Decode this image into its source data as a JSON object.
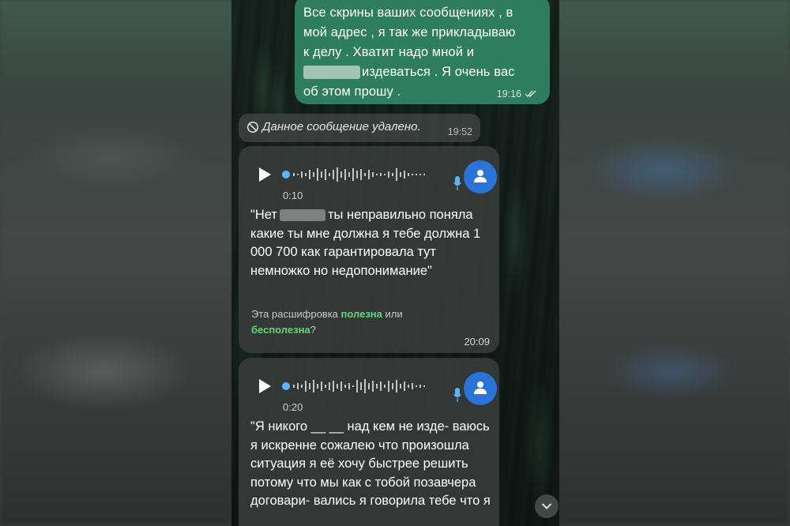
{
  "outgoing": {
    "text_line1": "Все скрины ваших сообщениях , в",
    "text_line2": "мой адрес , я так же прикладываю",
    "text_line3": "к делу . Хватит надо мной и",
    "text_line4": "издеваться . Я очень вас",
    "text_line5": "об этом прошу .",
    "time": "19:16",
    "status_icon": "double-check-icon"
  },
  "deleted": {
    "icon": "block-icon",
    "label": "Данное сообщение удалено.",
    "time": "19:52"
  },
  "voice_messages": [
    {
      "duration": "0:10",
      "transcript_start": "\"Нет",
      "transcript_rest": "ты неправильно поняла какие ты мне должна я тебе должна 1 000 700 как гарантировала тут немножко но недопонимание\"",
      "feedback_prefix": "Эта расшифровка ",
      "feedback_useful": "полезна",
      "feedback_or": " или ",
      "feedback_useless": "бесполезна",
      "feedback_q": "?",
      "time": "20:09"
    },
    {
      "duration": "0:20",
      "transcript": "\"Я никого __ __ над кем не изде- ваюсь я искренне сожалею что произошла ситуация я её хочу быстрее решить потому что мы как с тобой позавчера договари- вались я говорила тебе что я"
    }
  ],
  "icons": {
    "play": "play-icon",
    "mic": "microphone-icon",
    "avatar": "user-avatar-icon",
    "scroll": "chevron-down-icon"
  },
  "colors": {
    "outgoing_bubble": "#2f7d5f",
    "incoming_bubble": "#363a39",
    "accent_green": "#63d47e",
    "avatar_blue": "#2a73d8"
  }
}
